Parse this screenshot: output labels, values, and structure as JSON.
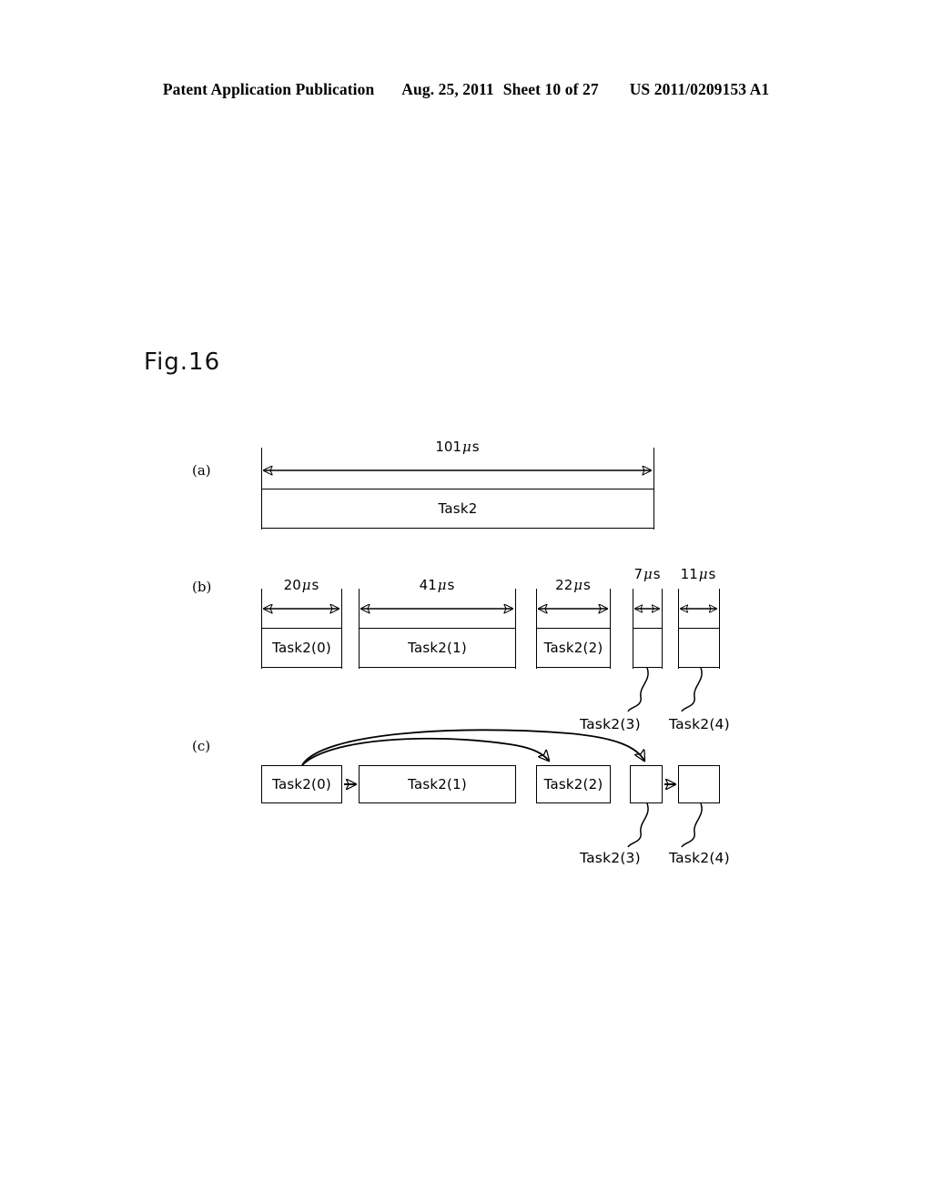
{
  "header": {
    "publication": "Patent Application Publication",
    "date": "Aug. 25, 2011",
    "sheet": "Sheet 10 of 27",
    "docnumber": "US 2011/0209153 A1"
  },
  "figure": {
    "label": "Fig.16",
    "sections": {
      "a_letter": "(a)",
      "b_letter": "(b)",
      "c_letter": "(c)"
    }
  },
  "panel_a": {
    "dimension": {
      "value": "101",
      "unit_mu": "μ",
      "unit_s": "s",
      "text": "101μs"
    },
    "block": {
      "label": "Task2"
    }
  },
  "panel_b": {
    "blocks": [
      {
        "label": "Task2(0)",
        "dimension": "20μs",
        "dim_value": "20",
        "unit_mu": "μ",
        "unit_s": "s",
        "inline_label": true
      },
      {
        "label": "Task2(1)",
        "dimension": "41μs",
        "dim_value": "41",
        "unit_mu": "μ",
        "unit_s": "s",
        "inline_label": true
      },
      {
        "label": "Task2(2)",
        "dimension": "22μs",
        "dim_value": "22",
        "unit_mu": "μ",
        "unit_s": "s",
        "inline_label": true
      },
      {
        "label": "Task2(3)",
        "dimension": "7μs",
        "dim_value": "7",
        "unit_mu": "μ",
        "unit_s": "s",
        "inline_label": false
      },
      {
        "label": "Task2(4)",
        "dimension": "11μs",
        "dim_value": "11",
        "unit_mu": "μ",
        "unit_s": "s",
        "inline_label": false
      }
    ],
    "leader_labels": [
      "Task2(3)",
      "Task2(4)"
    ]
  },
  "panel_c": {
    "blocks": [
      {
        "label": "Task2(0)",
        "inline_label": true
      },
      {
        "label": "Task2(1)",
        "inline_label": true
      },
      {
        "label": "Task2(2)",
        "inline_label": true
      },
      {
        "label": "Task2(3)",
        "inline_label": false
      },
      {
        "label": "Task2(4)",
        "inline_label": false
      }
    ],
    "leader_labels": [
      "Task2(3)",
      "Task2(4)"
    ],
    "flow_arrows": [
      {
        "from": "Task2(0)",
        "to": "Task2(1)",
        "style": "straight"
      },
      {
        "from": "Task2(3)",
        "to": "Task2(4)",
        "style": "straight"
      },
      {
        "from": "Task2(0)",
        "to": "Task2(2)",
        "style": "curved"
      },
      {
        "from": "Task2(0)",
        "to": "Task2(3)",
        "style": "curved"
      }
    ]
  },
  "colors": {
    "ink": "#000000",
    "paper": "#ffffff"
  }
}
